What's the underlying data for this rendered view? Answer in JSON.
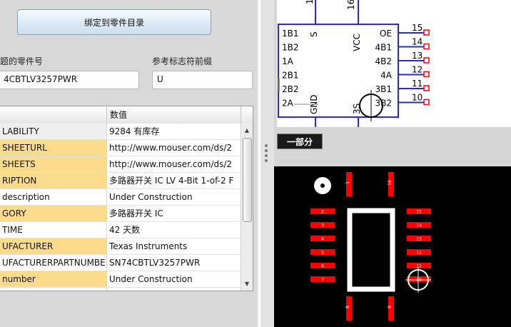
{
  "toolbar": {
    "bind_button_label": "绑定到零件目录"
  },
  "fields": {
    "part_number_label": "题的零件号",
    "part_number_value": "4CBTLV3257PWR",
    "ref_prefix_label": "参考标志符前缀",
    "ref_prefix_value": "U"
  },
  "grid": {
    "columns": [
      "",
      "数值"
    ],
    "rows": [
      {
        "name": "LABILITY",
        "value": "9284 有库存",
        "highlight": false
      },
      {
        "name": "SHEETURL",
        "value": "http://www.mouser.com/ds/2",
        "highlight": true
      },
      {
        "name": "SHEETS",
        "value": "http://www.mouser.com/ds/2",
        "highlight": true
      },
      {
        "name": "RIPTION",
        "value": "多路器开关 IC LV 4-Bit 1-of-2 F",
        "highlight": true
      },
      {
        "name": "description",
        "value": "Under Construction",
        "highlight": false
      },
      {
        "name": "GORY",
        "value": "多路器开关 IC",
        "highlight": true
      },
      {
        "name": "TIME",
        "value": "42 天数",
        "highlight": false
      },
      {
        "name": "UFACTURER",
        "value": "Texas Instruments",
        "highlight": true
      },
      {
        "name": "UFACTURERPARTNUMBER",
        "value": "SN74CBTLV3257PWR",
        "highlight": false
      },
      {
        "name": "number",
        "value": "Under Construction",
        "highlight": true
      },
      {
        "name": "",
        "value": "",
        "highlight": false
      }
    ]
  },
  "schematic": {
    "top_pins": [
      "1",
      "16"
    ],
    "power_labels": [
      "S",
      "VCC",
      "GND",
      "3S"
    ],
    "left_pins": [
      "1B1",
      "1B2",
      "1A",
      "2B1",
      "2B2",
      "2A"
    ],
    "right_pins": [
      {
        "label": "OE",
        "num": "15"
      },
      {
        "label": "4B1",
        "num": "14"
      },
      {
        "label": "4B2",
        "num": "13"
      },
      {
        "label": "4A",
        "num": "12"
      },
      {
        "label": "3B1",
        "num": "11"
      },
      {
        "label": "3B2",
        "num": "10"
      }
    ]
  },
  "tab": {
    "label": "一部分"
  },
  "pcb": {
    "left_pads": [
      "2",
      "3",
      "4",
      "5",
      "6",
      "7"
    ],
    "right_pads": [
      "15",
      "14",
      "13",
      "12",
      "11",
      "10"
    ],
    "top_pads": [
      "1",
      "16"
    ],
    "bottom_pads": [
      "8",
      "9"
    ],
    "colors": {
      "pad": "#ff0000",
      "outline": "#ffffff",
      "background": "#000000"
    }
  }
}
